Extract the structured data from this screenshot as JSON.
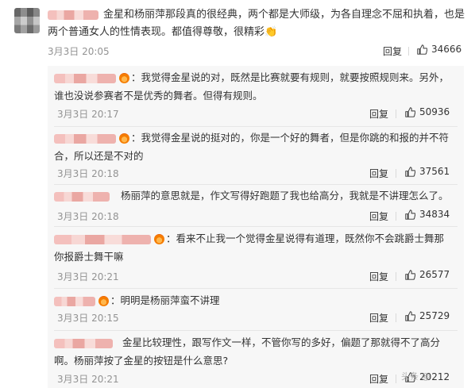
{
  "main": {
    "text": "金星和杨丽萍那段真的很经典，两个都是大师级，为各自理念不屈和执着，也是两个普通女人的性情表现。都值得尊敬，很精彩",
    "emoji": "👏",
    "time": "3月3日 20:05",
    "reply_label": "回复",
    "likes": "34666"
  },
  "replies": [
    {
      "text": "：我觉得金星说的对，既然是比赛就要有规则，就要按照规则来。另外，谁也没说参赛者不是优秀的舞者。但得有规则。",
      "time": "3月3日 20:17",
      "reply_label": "回复",
      "likes": "50936"
    },
    {
      "text": "：我觉得金星说的挺对的，你是一个好的舞者，但是你跳的和报的并不符合，所以还是不对的",
      "time": "3月3日 20:18",
      "reply_label": "回复",
      "likes": "37561"
    },
    {
      "text": "杨丽萍的意思就是，作文写得好跑题了我也给高分，我就是不讲理怎么了。",
      "time": "3月3日 20:18",
      "reply_label": "回复",
      "likes": "34834"
    },
    {
      "text": "：看来不止我一个觉得金星说得有道理，既然你不会跳爵士舞那你报爵士舞干嘛",
      "time": "3月3日 20:21",
      "reply_label": "回复",
      "likes": "26577"
    },
    {
      "text": "：明明是杨丽萍蛮不讲理",
      "time": "3月3日 20:15",
      "reply_label": "回复",
      "likes": "25729"
    },
    {
      "text": "金星比较理性，跟写作文一样，不管你写的多好，偏题了那就得不了高分啊。杨丽萍按了金星的按钮是什么意思?",
      "time": "3月3日 20:21",
      "reply_label": "回复",
      "likes": "20212"
    }
  ],
  "watermark": "头条 @"
}
